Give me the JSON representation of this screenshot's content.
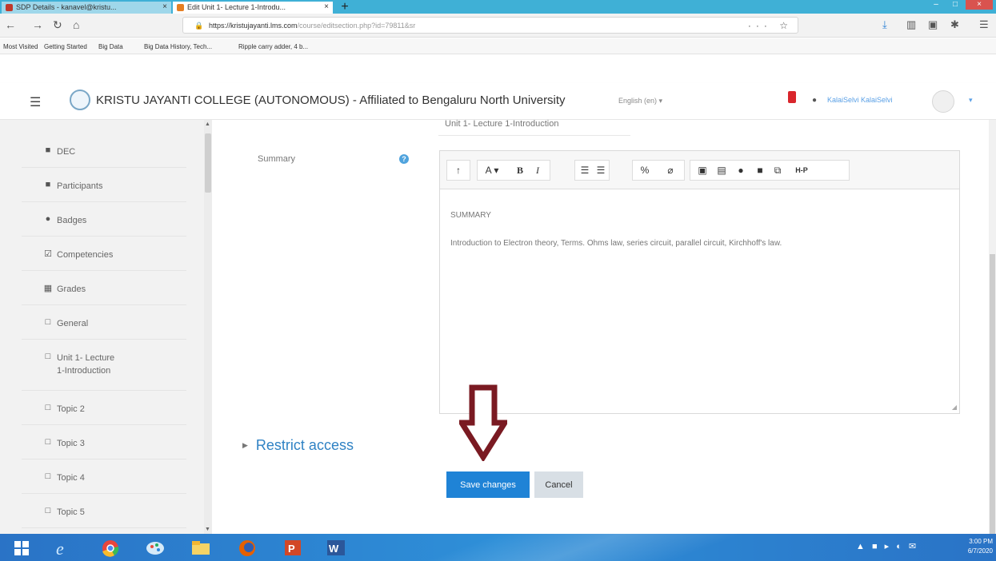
{
  "browser": {
    "tabs": [
      {
        "label": "SDP Details - kanavel@kristu..."
      },
      {
        "label": "Edit Unit 1- Lecture 1-Introdu..."
      }
    ],
    "new_tab": "+",
    "url_host": "https://kristujayanti.lms.com",
    "url_path": "/course/editsection.php?id=79811&sr",
    "url_more": "··· ☆",
    "bookmarks": [
      {
        "label": "Most Visited"
      },
      {
        "label": "Getting Started"
      },
      {
        "label": "Big Data"
      },
      {
        "label": "Big Data History, Tech..."
      },
      {
        "label": "Ripple carry adder, 4 b..."
      }
    ]
  },
  "header": {
    "site_name": "KRISTU JAYANTI COLLEGE (AUTONOMOUS) - Affiliated to Bengaluru North University",
    "language": "English (en) ▾",
    "user_name": "KalaiSelvi KalaiSelvi",
    "user_menu": "▾"
  },
  "sidebar": {
    "items": [
      {
        "icon": "graduation-cap-icon",
        "glyph": "■",
        "label": "DEC"
      },
      {
        "icon": "users-icon",
        "glyph": "■",
        "label": "Participants"
      },
      {
        "icon": "shield-icon",
        "glyph": "●",
        "label": "Badges"
      },
      {
        "icon": "check-square-icon",
        "glyph": "☑",
        "label": "Competencies"
      },
      {
        "icon": "table-icon",
        "glyph": "▦",
        "label": "Grades"
      },
      {
        "icon": "folder-icon",
        "glyph": "□",
        "label": "General"
      },
      {
        "icon": "folder-icon",
        "glyph": "□",
        "label": "Unit 1- Lecture",
        "label2": "1-Introduction"
      },
      {
        "icon": "folder-icon",
        "glyph": "□",
        "label": "Topic 2"
      },
      {
        "icon": "folder-icon",
        "glyph": "□",
        "label": "Topic 3"
      },
      {
        "icon": "folder-icon",
        "glyph": "□",
        "label": "Topic 4"
      },
      {
        "icon": "folder-icon",
        "glyph": "□",
        "label": "Topic 5"
      }
    ]
  },
  "form": {
    "section_name_value": "Unit 1- Lecture 1-Introduction",
    "summary_label": "Summary",
    "help_glyph": "?",
    "toolbar": {
      "collapse": "↑",
      "font": "A ▾",
      "bold": "B",
      "italic": "I",
      "ul": "☰",
      "ol": "☰",
      "link": "%",
      "unlink": "⌀",
      "image": "▣",
      "media": "▤",
      "record_audio": "●",
      "record_video": "■",
      "manage_files": "⧉",
      "h5p": "H-P"
    },
    "summary_heading": "SUMMARY",
    "summary_text": "Introduction to Electron theory, Terms. Ohms law, series circuit, parallel circuit, Kirchhoff's law.",
    "restrict_access": "Restrict access",
    "save_label": "Save changes",
    "cancel_label": "Cancel"
  },
  "taskbar": {
    "tray": "▲ ■ ▸ ◐ ✉",
    "time": "3:00 PM",
    "date": "6/7/2020"
  },
  "colors": {
    "accent": "#1f83d6",
    "annotation_arrow": "#7a1a22",
    "notification": "#d9262c",
    "taskbar": "#2e8fd8"
  }
}
